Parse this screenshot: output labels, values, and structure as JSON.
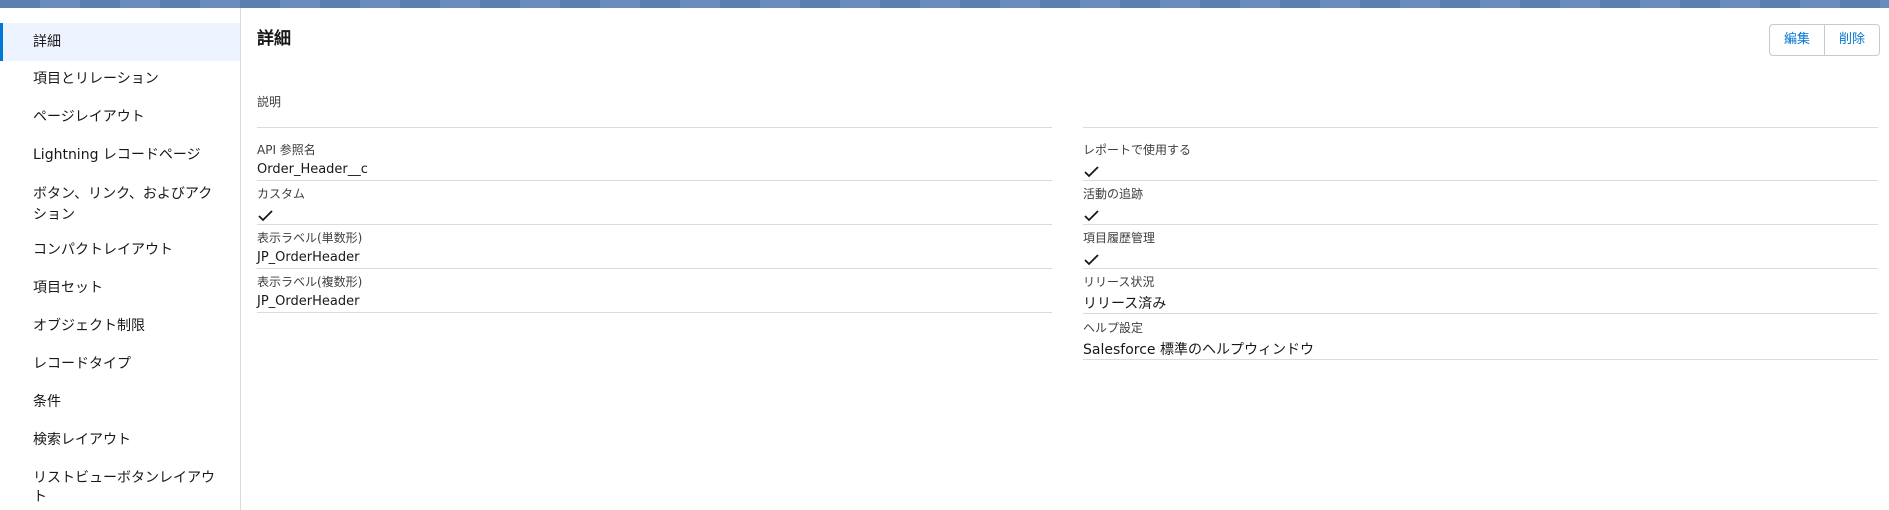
{
  "sidebar": {
    "items": [
      {
        "label": "詳細"
      },
      {
        "label": "項目とリレーション"
      },
      {
        "label": "ページレイアウト"
      },
      {
        "label": "Lightning レコードページ"
      },
      {
        "label": "ボタン、リンク、およびアクション"
      },
      {
        "label": "コンパクトレイアウト"
      },
      {
        "label": "項目セット"
      },
      {
        "label": "オブジェクト制限"
      },
      {
        "label": "レコードタイプ"
      },
      {
        "label": "条件"
      },
      {
        "label": "検索レイアウト"
      },
      {
        "label": "リストビューボタンレイアウト"
      }
    ]
  },
  "main": {
    "title": "詳細",
    "buttons": {
      "edit": "編集",
      "delete": "削除"
    },
    "description_label": "説明",
    "left_fields": [
      {
        "label": "API 参照名",
        "value": "Order_Header__c"
      },
      {
        "label": "カスタム",
        "value": "✓"
      },
      {
        "label": "表示ラベル(単数形)",
        "value": "JP_OrderHeader"
      },
      {
        "label": "表示ラベル(複数形)",
        "value": "JP_OrderHeader"
      }
    ],
    "right_fields": [
      {
        "label": "レポートで使用する",
        "value": "✓"
      },
      {
        "label": "活動の追跡",
        "value": "✓"
      },
      {
        "label": "項目履歴管理",
        "value": "✓"
      },
      {
        "label": "リリース状況",
        "value": "リリース済み"
      },
      {
        "label": "ヘルプ設定",
        "value": "Salesforce 標準のヘルプウィンドウ"
      }
    ]
  }
}
